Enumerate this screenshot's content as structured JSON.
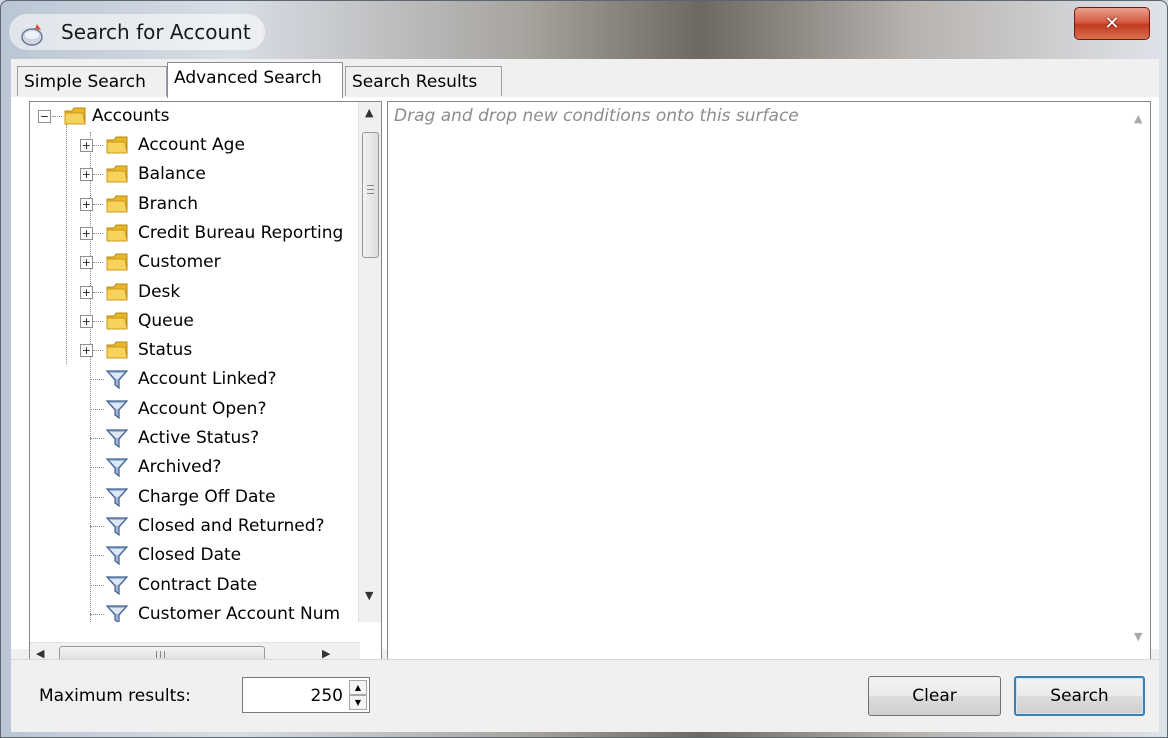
{
  "window": {
    "title": "Search for Account",
    "close_glyph": "✕",
    "icon": "search-app-icon"
  },
  "tabs": [
    {
      "label": "Simple Search",
      "active": false
    },
    {
      "label": "Advanced Search",
      "active": true
    },
    {
      "label": "Search Results",
      "active": false
    }
  ],
  "tree": {
    "root": {
      "label": "Accounts",
      "expander": "−",
      "icon": "folder-icon"
    },
    "folders": [
      {
        "label": "Account Age",
        "expander": "+"
      },
      {
        "label": "Balance",
        "expander": "+"
      },
      {
        "label": "Branch",
        "expander": "+"
      },
      {
        "label": "Credit Bureau Reporting",
        "expander": "+"
      },
      {
        "label": "Customer",
        "expander": "+"
      },
      {
        "label": "Desk",
        "expander": "+"
      },
      {
        "label": "Queue",
        "expander": "+"
      },
      {
        "label": "Status",
        "expander": "+"
      }
    ],
    "conditions": [
      {
        "label": "Account Linked?"
      },
      {
        "label": "Account Open?"
      },
      {
        "label": "Active Status?"
      },
      {
        "label": "Archived?"
      },
      {
        "label": "Charge Off Date"
      },
      {
        "label": "Closed and Returned?"
      },
      {
        "label": "Closed Date"
      },
      {
        "label": "Contract Date"
      },
      {
        "label": "Customer Account Num"
      }
    ]
  },
  "surface": {
    "hint": "Drag and drop new conditions onto this surface"
  },
  "bottom": {
    "max_results_label": "Maximum results:",
    "max_results_value": "250",
    "clear_label": "Clear",
    "search_label": "Search"
  },
  "colors": {
    "folder": "#f2c23a",
    "funnel": "#5b7fb0",
    "close": "#c33a1f"
  }
}
